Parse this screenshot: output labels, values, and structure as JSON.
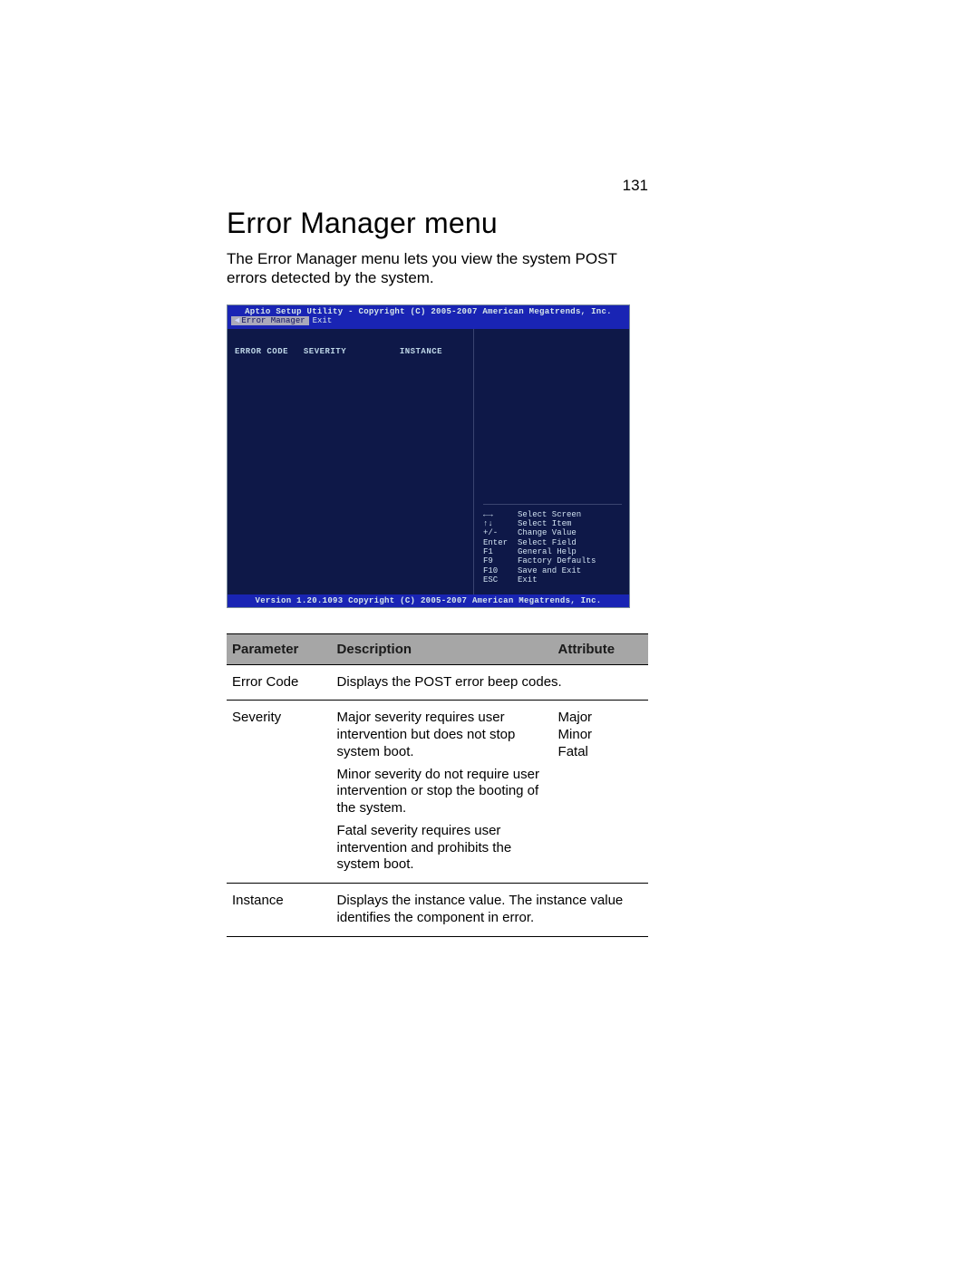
{
  "page_number": "131",
  "title": "Error Manager menu",
  "intro": "The Error Manager menu lets you view the system POST errors detected by the system.",
  "bios": {
    "copyright_top": "Aptio Setup Utility - Copyright (C) 2005-2007 American Megatrends, Inc.",
    "tab_active": "Error Manager",
    "tab_exit": "Exit",
    "col_error": "ERROR CODE",
    "col_severity": "SEVERITY",
    "col_instance": "INSTANCE",
    "help": [
      {
        "k": "←→",
        "v": "Select Screen"
      },
      {
        "k": "↑↓",
        "v": "Select Item"
      },
      {
        "k": "+/-",
        "v": "Change Value"
      },
      {
        "k": "Enter",
        "v": "Select Field"
      },
      {
        "k": "F1",
        "v": "General Help"
      },
      {
        "k": "F9",
        "v": "Factory Defaults"
      },
      {
        "k": "F10",
        "v": "Save and Exit"
      },
      {
        "k": "ESC",
        "v": "Exit"
      }
    ],
    "copyright_bottom": "Version 1.20.1093 Copyright (C) 2005-2007 American Megatrends, Inc."
  },
  "table": {
    "headers": {
      "param": "Parameter",
      "desc": "Description",
      "attr": "Attribute"
    },
    "rows": [
      {
        "param": "Error Code",
        "desc": [
          "Displays the POST error beep codes."
        ],
        "attr": []
      },
      {
        "param": "Severity",
        "desc": [
          "Major severity requires user intervention but does not stop system boot.",
          "Minor severity do not require user intervention or stop the booting of the system.",
          "Fatal severity requires user intervention and prohibits the system boot."
        ],
        "attr": [
          "Major",
          "Minor",
          "Fatal"
        ]
      },
      {
        "param": "Instance",
        "desc": [
          "Displays the instance value. The instance value identifies the component in error."
        ],
        "attr": []
      }
    ]
  }
}
